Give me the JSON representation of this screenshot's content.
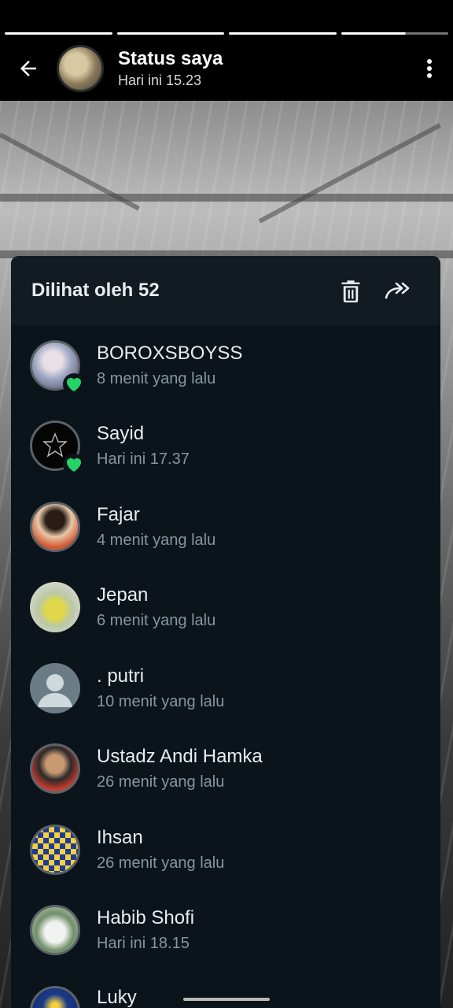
{
  "header": {
    "title": "Status saya",
    "subtitle": "Hari ini 15.23"
  },
  "progress": {
    "segments": 4,
    "current_segment_fill": 0.45
  },
  "sheet": {
    "title": "Dilihat oleh 52",
    "delete_icon": "trash-icon",
    "forward_icon": "forward-icon"
  },
  "viewers": [
    {
      "name": "BOROXSBOYSS",
      "time": "8 menit yang lalu",
      "liked": true
    },
    {
      "name": "Sayid",
      "time": "Hari ini 17.37",
      "liked": true
    },
    {
      "name": "Fajar",
      "time": "4 menit yang lalu",
      "liked": false
    },
    {
      "name": "Jepan",
      "time": "6 menit yang lalu",
      "liked": false
    },
    {
      "name": ". putri",
      "time": "10 menit yang lalu",
      "liked": false
    },
    {
      "name": "Ustadz Andi Hamka",
      "time": "26 menit yang lalu",
      "liked": false
    },
    {
      "name": "Ihsan",
      "time": "26 menit yang lalu",
      "liked": false
    },
    {
      "name": "Habib Shofi",
      "time": "Hari ini 18.15",
      "liked": false
    },
    {
      "name": "Luky",
      "time": "",
      "liked": false
    }
  ],
  "colors": {
    "sheet_bg": "#0b141a",
    "sheet_header_bg": "#111b21",
    "heart": "#25d366",
    "secondary_text": "#8696a0"
  }
}
